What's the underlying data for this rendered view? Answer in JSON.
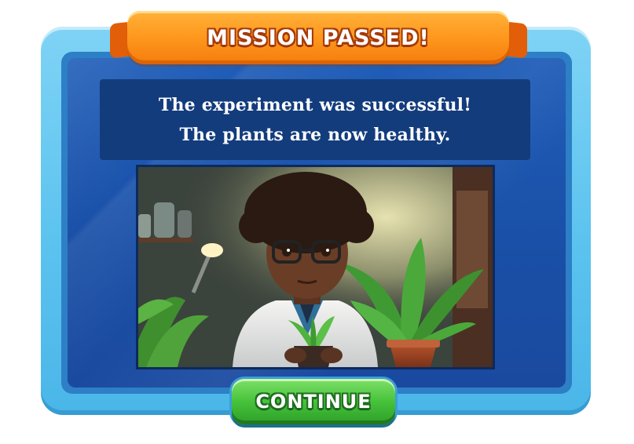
{
  "banner": {
    "title": "MISSION PASSED!"
  },
  "message": {
    "line1": "The experiment was successful!",
    "line2": "The plants are now healthy."
  },
  "illustration": {
    "subject": "young scientist in lab coat and glasses holding a small potted plant next to a larger potted plant"
  },
  "continue_button": {
    "label": "CONTINUE"
  },
  "colors": {
    "frame": "#5cc3ef",
    "panel": "#1f5db8",
    "banner": "#ff9a1f",
    "button": "#46c23a"
  }
}
